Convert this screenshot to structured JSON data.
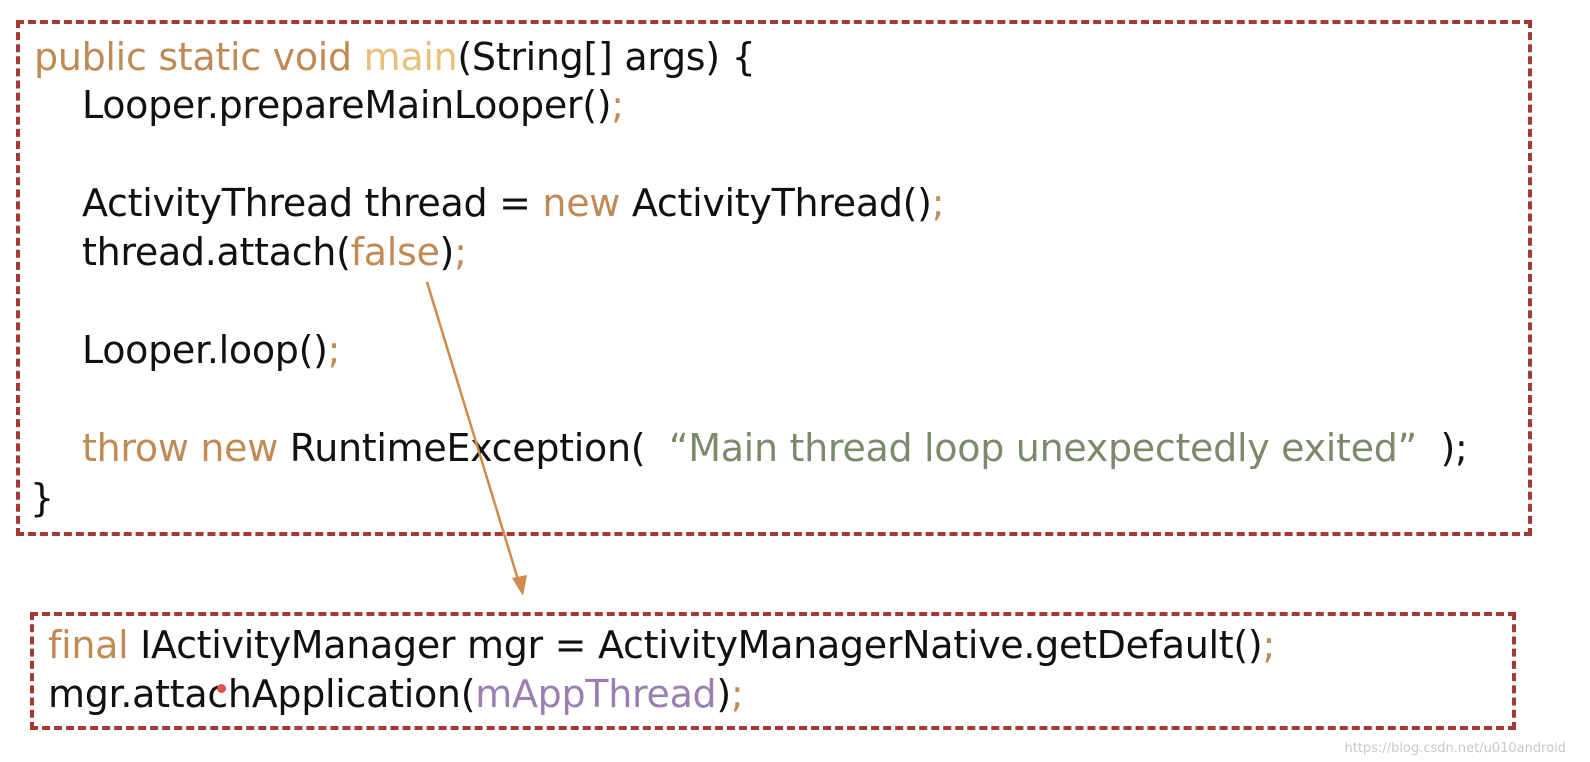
{
  "top_block": {
    "line1": {
      "kw": "public static void ",
      "fn": "main",
      "rest": "(String[] args) {"
    },
    "line2": {
      "text": "Looper.prepareMainLooper()",
      "semi": ";"
    },
    "line3": {
      "pre": "ActivityThread thread = ",
      "kw": "new",
      "post": " ActivityThread()",
      "semi": ";"
    },
    "line4": {
      "pre": "thread.attach(",
      "kw": "false",
      "post": ")",
      "semi": ";"
    },
    "line5": {
      "text": "Looper.loop()",
      "semi": ";"
    },
    "line6": {
      "kw": "throw new",
      "pre": " RuntimeException(  ",
      "str": "“Main thread loop unexpectedly exited”",
      "post": "  );"
    },
    "line7": {
      "text": "}"
    }
  },
  "bottom_block": {
    "line1": {
      "kw": "final",
      "pre": " IActivityManager mgr = ActivityManagerNative.getDefault()",
      "semi": ";"
    },
    "line2": {
      "pre": "mgr.attachApplication(",
      "purple": "mAppThread",
      "post": ")",
      "semi": ";"
    }
  },
  "colors": {
    "border": "#a53a32",
    "keyword": "#c08a55",
    "method_name": "#e8c07a",
    "string": "#7a8a6a",
    "field": "#9a7fb0",
    "arrow": "#d08a4a"
  },
  "watermark": "https://blog.csdn.net/u010andro​id"
}
